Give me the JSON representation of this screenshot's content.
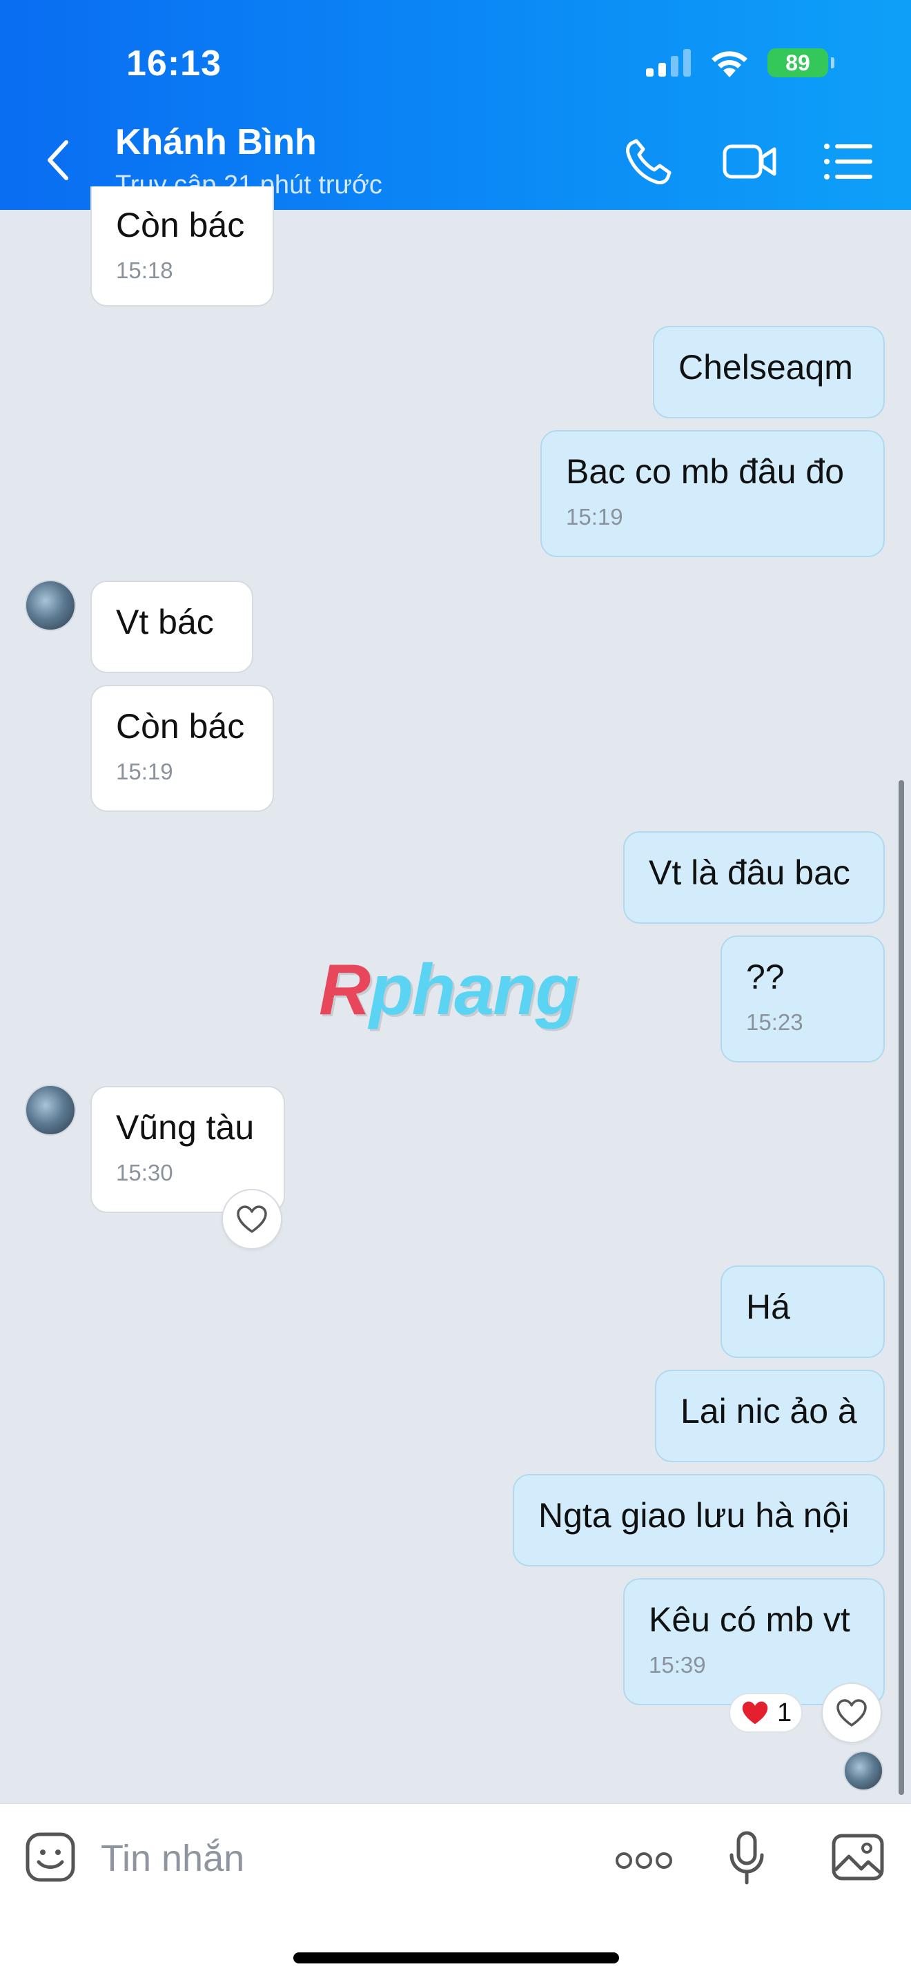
{
  "status_bar": {
    "time": "16:13",
    "battery": "89"
  },
  "header": {
    "contact_name": "Khánh Bình",
    "status": "Truy cập 21 phút trước"
  },
  "messages": [
    {
      "dir": "in",
      "text": "Còn bác",
      "time": "15:18"
    },
    {
      "dir": "out",
      "text": "Chelseaqm"
    },
    {
      "dir": "out",
      "text": "Bac co mb đâu đo",
      "time": "15:19"
    },
    {
      "dir": "in",
      "text": "Vt bác"
    },
    {
      "dir": "in",
      "text": "Còn bác",
      "time": "15:19"
    },
    {
      "dir": "out",
      "text": "Vt là đâu bac"
    },
    {
      "dir": "out",
      "text": "??",
      "time": "15:23"
    },
    {
      "dir": "in",
      "text": "Vũng tàu",
      "time": "15:30"
    },
    {
      "dir": "out",
      "text": "Há"
    },
    {
      "dir": "out",
      "text": "Lai nic ảo à"
    },
    {
      "dir": "out",
      "text": "Ngta giao lưu hà nội"
    },
    {
      "dir": "out",
      "text": "Kêu có mb vt",
      "time": "15:39",
      "reaction_count": "1"
    }
  ],
  "watermark": {
    "first": "R",
    "rest": "phang"
  },
  "composer": {
    "placeholder": "Tin nhắn"
  }
}
